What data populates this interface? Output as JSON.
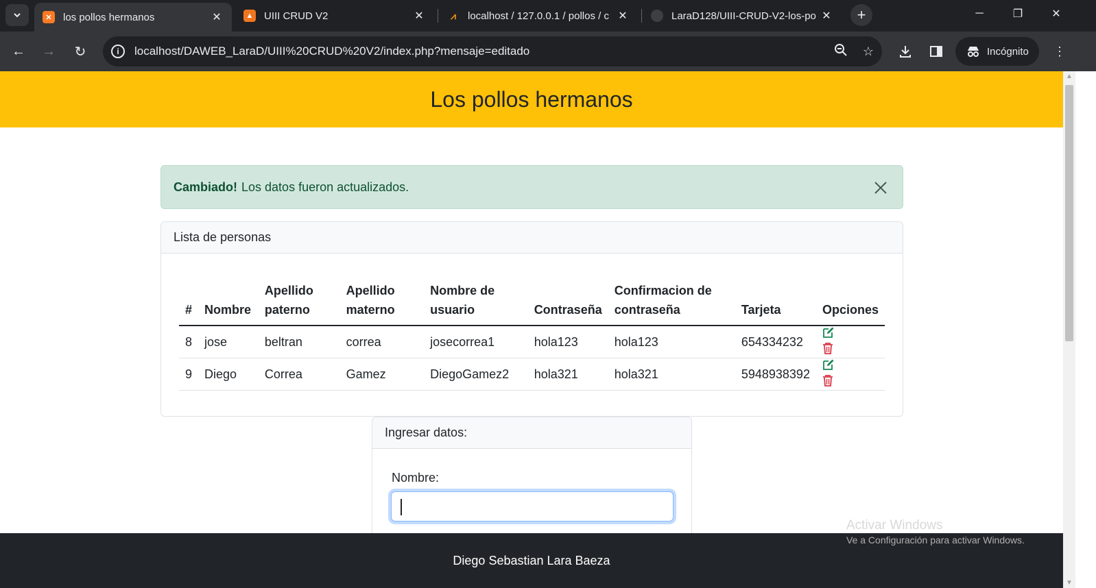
{
  "browser": {
    "tabs": [
      {
        "title": "los pollos hermanos",
        "active": true,
        "favicon_color": "#fb7a24",
        "favicon_glyph": "X"
      },
      {
        "title": "UIII CRUD V2",
        "active": false,
        "favicon_color": "#f0761f",
        "favicon_glyph": "▲"
      },
      {
        "title": "localhost / 127.0.0.1 / pollos / c",
        "active": false,
        "favicon_color": "#f29111",
        "favicon_glyph": "pma"
      },
      {
        "title": "LaraD128/UIII-CRUD-V2-los-po",
        "active": false,
        "favicon_color": "#3c4043",
        "favicon_glyph": "gh"
      }
    ],
    "url": "localhost/DAWEB_LaraD/UIII%20CRUD%20V2/index.php?mensaje=editado",
    "incognito_label": "Incógnito"
  },
  "page": {
    "header_title": "Los pollos hermanos",
    "alert": {
      "strong": "Cambiado!",
      "text": "Los datos fueron actualizados."
    },
    "list_card": {
      "title": "Lista de personas",
      "columns": [
        {
          "line1": "",
          "line2": "#"
        },
        {
          "line1": "",
          "line2": "Nombre"
        },
        {
          "line1": "Apellido",
          "line2": "paterno"
        },
        {
          "line1": "Apellido",
          "line2": "materno"
        },
        {
          "line1": "Nombre de",
          "line2": "usuario"
        },
        {
          "line1": "",
          "line2": "Contraseña"
        },
        {
          "line1": "Confirmacion de",
          "line2": "contraseña"
        },
        {
          "line1": "",
          "line2": "Tarjeta"
        },
        {
          "line1": "",
          "line2": "Opciones"
        }
      ],
      "rows": [
        {
          "id": "8",
          "nombre": "jose",
          "apellido_paterno": "beltran",
          "apellido_materno": "correa",
          "usuario": "josecorrea1",
          "contrasena": "hola123",
          "confirmacion": "hola123",
          "tarjeta": "654334232"
        },
        {
          "id": "9",
          "nombre": "Diego",
          "apellido_paterno": "Correa",
          "apellido_materno": "Gamez",
          "usuario": "DiegoGamez2",
          "contrasena": "hola321",
          "confirmacion": "hola321",
          "tarjeta": "5948938392"
        }
      ]
    },
    "form_card": {
      "title": "Ingresar datos:",
      "nombre_label": "Nombre:",
      "nombre_value": ""
    },
    "footer_text": "Diego Sebastian Lara Baeza",
    "watermark": {
      "line1": "Activar Windows",
      "line2": "Ve a Configuración para activar Windows."
    }
  },
  "colors": {
    "header": "#ffc107",
    "alert_bg": "#d1e7dd",
    "alert_text": "#0f5132",
    "edit_icon": "#198754",
    "delete_icon": "#dc3545",
    "footer": "#212529"
  },
  "icons": {
    "edit": "pencil-square-icon",
    "delete": "trash-icon"
  }
}
